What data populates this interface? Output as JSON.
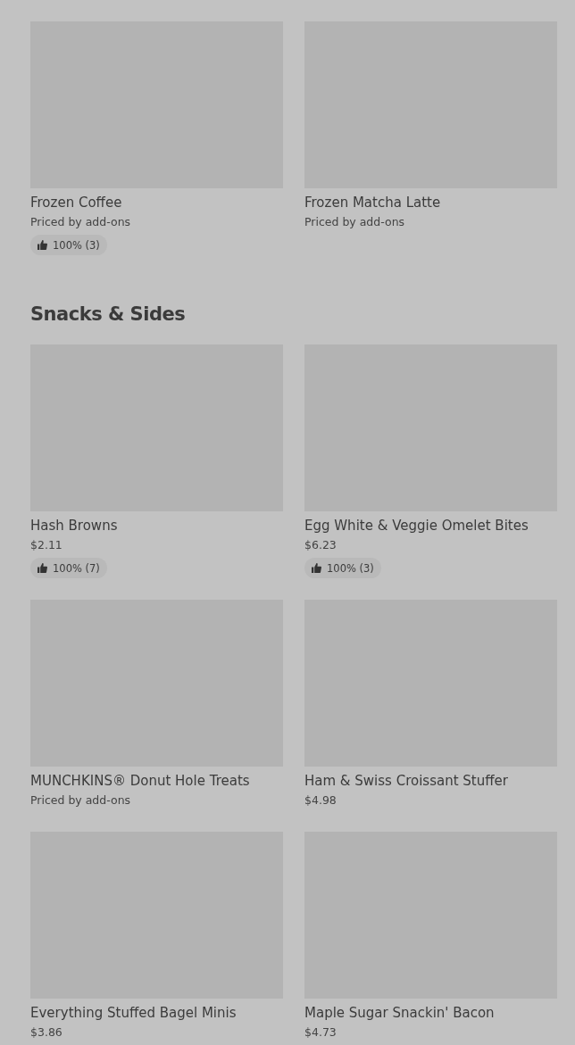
{
  "sections": [
    {
      "items": [
        {
          "name": "Frozen Coffee",
          "price": "Priced by add-ons",
          "rating": "100% (3)"
        },
        {
          "name": "Frozen Matcha Latte",
          "price": "Priced by add-ons"
        }
      ]
    },
    {
      "title": "Snacks & Sides",
      "items": [
        {
          "name": "Hash Browns",
          "price": "$2.11",
          "rating": "100% (7)"
        },
        {
          "name": "Egg White & Veggie Omelet Bites",
          "price": "$6.23",
          "rating": "100% (3)"
        },
        {
          "name": "MUNCHKINS® Donut Hole Treats",
          "price": "Priced by add-ons"
        },
        {
          "name": "Ham & Swiss Croissant Stuffer",
          "price": "$4.98"
        },
        {
          "name": "Everything Stuffed Bagel Minis",
          "price": "$3.86"
        },
        {
          "name": "Maple Sugar Snackin' Bacon",
          "price": "$4.73"
        }
      ]
    }
  ]
}
